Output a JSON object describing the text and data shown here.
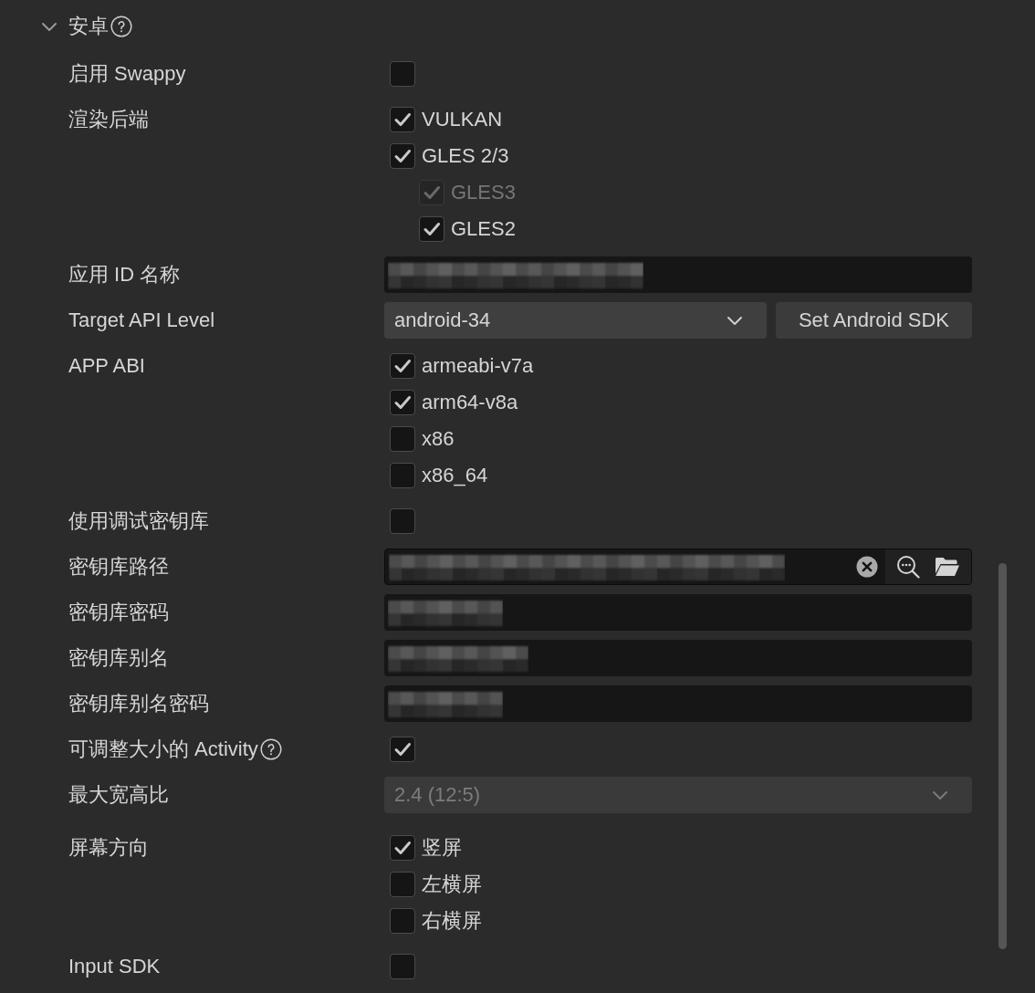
{
  "section": {
    "title": "安卓",
    "expanded": true,
    "help": true
  },
  "rows": [
    {
      "kind": "checkbox",
      "label": "启用 Swappy",
      "help": false,
      "checked": false
    },
    {
      "kind": "checklist",
      "label": "渲染后端",
      "options": [
        {
          "label": "VULKAN",
          "checked": true,
          "disabled": false
        },
        {
          "label": "GLES 2/3",
          "checked": true,
          "disabled": false,
          "children": [
            {
              "label": "GLES3",
              "checked": true,
              "disabled": true
            },
            {
              "label": "GLES2",
              "checked": true,
              "disabled": false
            }
          ]
        }
      ]
    },
    {
      "kind": "text",
      "label": "应用 ID 名称",
      "obscured": true
    },
    {
      "kind": "select_button",
      "label": "Target API Level",
      "value": "android-34",
      "disabled": false,
      "button": "Set Android SDK"
    },
    {
      "kind": "checklist",
      "label": "APP ABI",
      "options": [
        {
          "label": "armeabi-v7a",
          "checked": true,
          "disabled": false
        },
        {
          "label": "arm64-v8a",
          "checked": true,
          "disabled": false
        },
        {
          "label": "x86",
          "checked": false,
          "disabled": false
        },
        {
          "label": "x86_64",
          "checked": false,
          "disabled": false
        }
      ]
    },
    {
      "kind": "checkbox",
      "label": "使用调试密钥库",
      "help": false,
      "checked": false
    },
    {
      "kind": "path",
      "label": "密钥库路径",
      "obscured": true
    },
    {
      "kind": "text",
      "label": "密钥库密码",
      "obscured": true
    },
    {
      "kind": "text",
      "label": "密钥库别名",
      "obscured": true
    },
    {
      "kind": "text",
      "label": "密钥库别名密码",
      "obscured": true
    },
    {
      "kind": "checkbox",
      "label": "可调整大小的 Activity",
      "help": true,
      "checked": true
    },
    {
      "kind": "select",
      "label": "最大宽高比",
      "value": "2.4 (12:5)",
      "disabled": true
    },
    {
      "kind": "checklist",
      "label": "屏幕方向",
      "options": [
        {
          "label": "竖屏",
          "checked": true,
          "disabled": false
        },
        {
          "label": "左横屏",
          "checked": false,
          "disabled": false
        },
        {
          "label": "右横屏",
          "checked": false,
          "disabled": false
        }
      ]
    },
    {
      "kind": "checkbox",
      "label": "Input SDK",
      "help": false,
      "checked": false
    }
  ]
}
